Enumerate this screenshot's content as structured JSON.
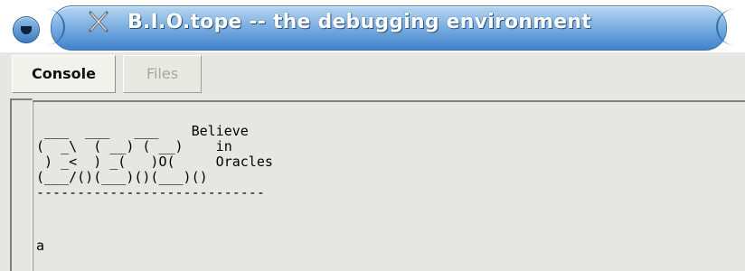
{
  "window": {
    "title": "B.I.O.tope -- the debugging environment",
    "icon": "x-icon",
    "menu_icon": "window-menu-icon"
  },
  "tabs": [
    {
      "label": "Console",
      "active": true
    },
    {
      "label": "Files",
      "active": false
    }
  ],
  "console": {
    "banner_lines": [
      " ____   ____   ____      Believe",
      "(  _ \\ (  __) (  _ )     in",
      " ) _ < ) __( ) O (    Oracles",
      "(____/()(____)()(____)()",
      "-----------------------------"
    ],
    "banner_text": " ___  ___   ___    Believe\n(  _\\  ( __) ( __)    in\n ) _<  ) _(   )O(     Oracles\n(___/()(___)()(___)()\n----------------------------",
    "input": "a"
  },
  "colors": {
    "title_gradient_top": "#b8d6f0",
    "title_gradient_bottom": "#3f82c9",
    "background": "#e6e7e2",
    "inactive_tab_text": "#a6a7a2"
  }
}
